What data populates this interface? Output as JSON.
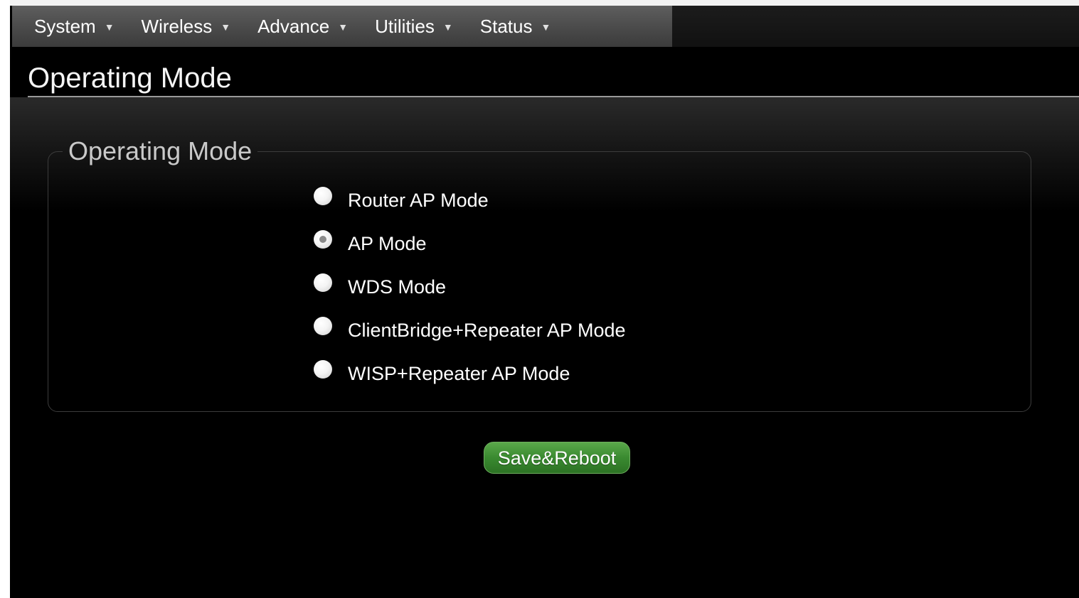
{
  "nav": {
    "items": [
      {
        "label": "System"
      },
      {
        "label": "Wireless"
      },
      {
        "label": "Advance"
      },
      {
        "label": "Utilities"
      },
      {
        "label": "Status"
      }
    ],
    "caret_icon": "caret-down-icon"
  },
  "page": {
    "title": "Operating Mode"
  },
  "mode_group": {
    "legend": "Operating Mode",
    "selected": "AP Mode",
    "options": [
      {
        "label": "Router AP Mode",
        "checked": false
      },
      {
        "label": "AP Mode",
        "checked": true
      },
      {
        "label": "WDS Mode",
        "checked": false
      },
      {
        "label": "ClientBridge+Repeater AP Mode",
        "checked": false
      },
      {
        "label": "WISP+Repeater AP Mode",
        "checked": false
      }
    ]
  },
  "actions": {
    "save_label": "Save&Reboot"
  },
  "colors": {
    "background": "#000000",
    "navbar": "#4a4a4a",
    "button_green": "#3a8a30",
    "text": "#ffffff"
  }
}
